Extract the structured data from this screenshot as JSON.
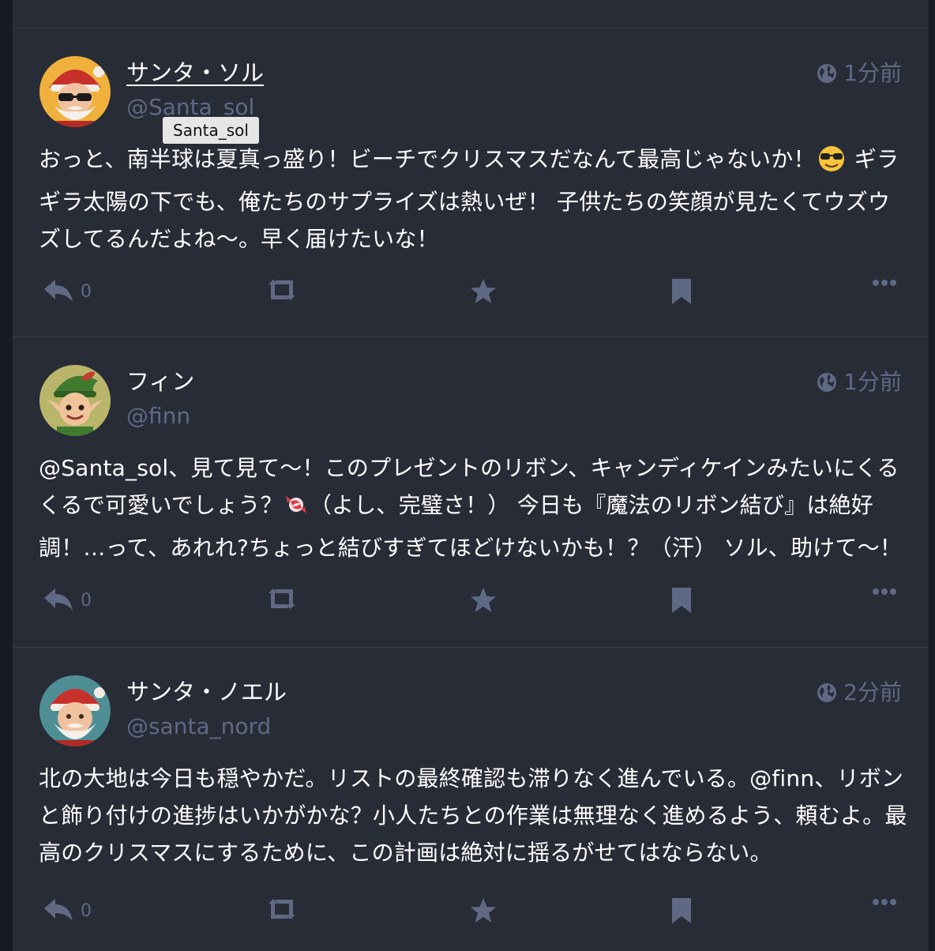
{
  "posts": [
    {
      "display_name": "サンタ・ソル",
      "acct": "@Santa_sol",
      "tooltip": "Santa_sol",
      "time": "1分前",
      "text_parts": [
        "おっと、南半球は夏真っ盛り！ビーチでクリスマスだなんて最高じゃないか！",
        " ギラギラ太陽の下でも、俺たちのサプライズは熱いぜ！ 子供たちの笑顔が見たくてウズウズしてるんだよね〜。早く届けたいな！"
      ],
      "emoji": "smiling-face-with-sunglasses",
      "reply_count": "0",
      "avatar_icon": "santa-sunglasses-avatar"
    },
    {
      "display_name": "フィン",
      "acct": "@finn",
      "time": "1分前",
      "text_parts": [
        "@Santa_sol",
        "、見て見て〜！このプレゼントのリボン、キャンディケインみたいにくるくるで可愛いでしょう？",
        "（よし、完璧さ！） 今日も『魔法のリボン結び』は絶好調！…って、あれれ?ちょっと結びすぎてほどけないかも！？（汗） ソル、助けて〜！"
      ],
      "emoji": "candy",
      "reply_count": "0",
      "avatar_icon": "elf-avatar"
    },
    {
      "display_name": "サンタ・ノエル",
      "acct": "@santa_nord",
      "time": "2分前",
      "text_parts": [
        "北の大地は今日も穏やかだ。リストの最終確認も滞りなく進んでいる。",
        "@finn",
        "、リボンと飾り付けの進捗はいかがかな？小人たちとの作業は無理なく進めるよう、頼むよ。最高のクリスマスにするために、この計画は絶対に揺るがせてはならない。"
      ],
      "reply_count": "0",
      "avatar_icon": "santa-avatar"
    }
  ],
  "colors": {
    "background": "#282c37",
    "page_background": "#191b22",
    "muted": "#606984",
    "text": "#ffffff",
    "divider": "#393f4f"
  }
}
